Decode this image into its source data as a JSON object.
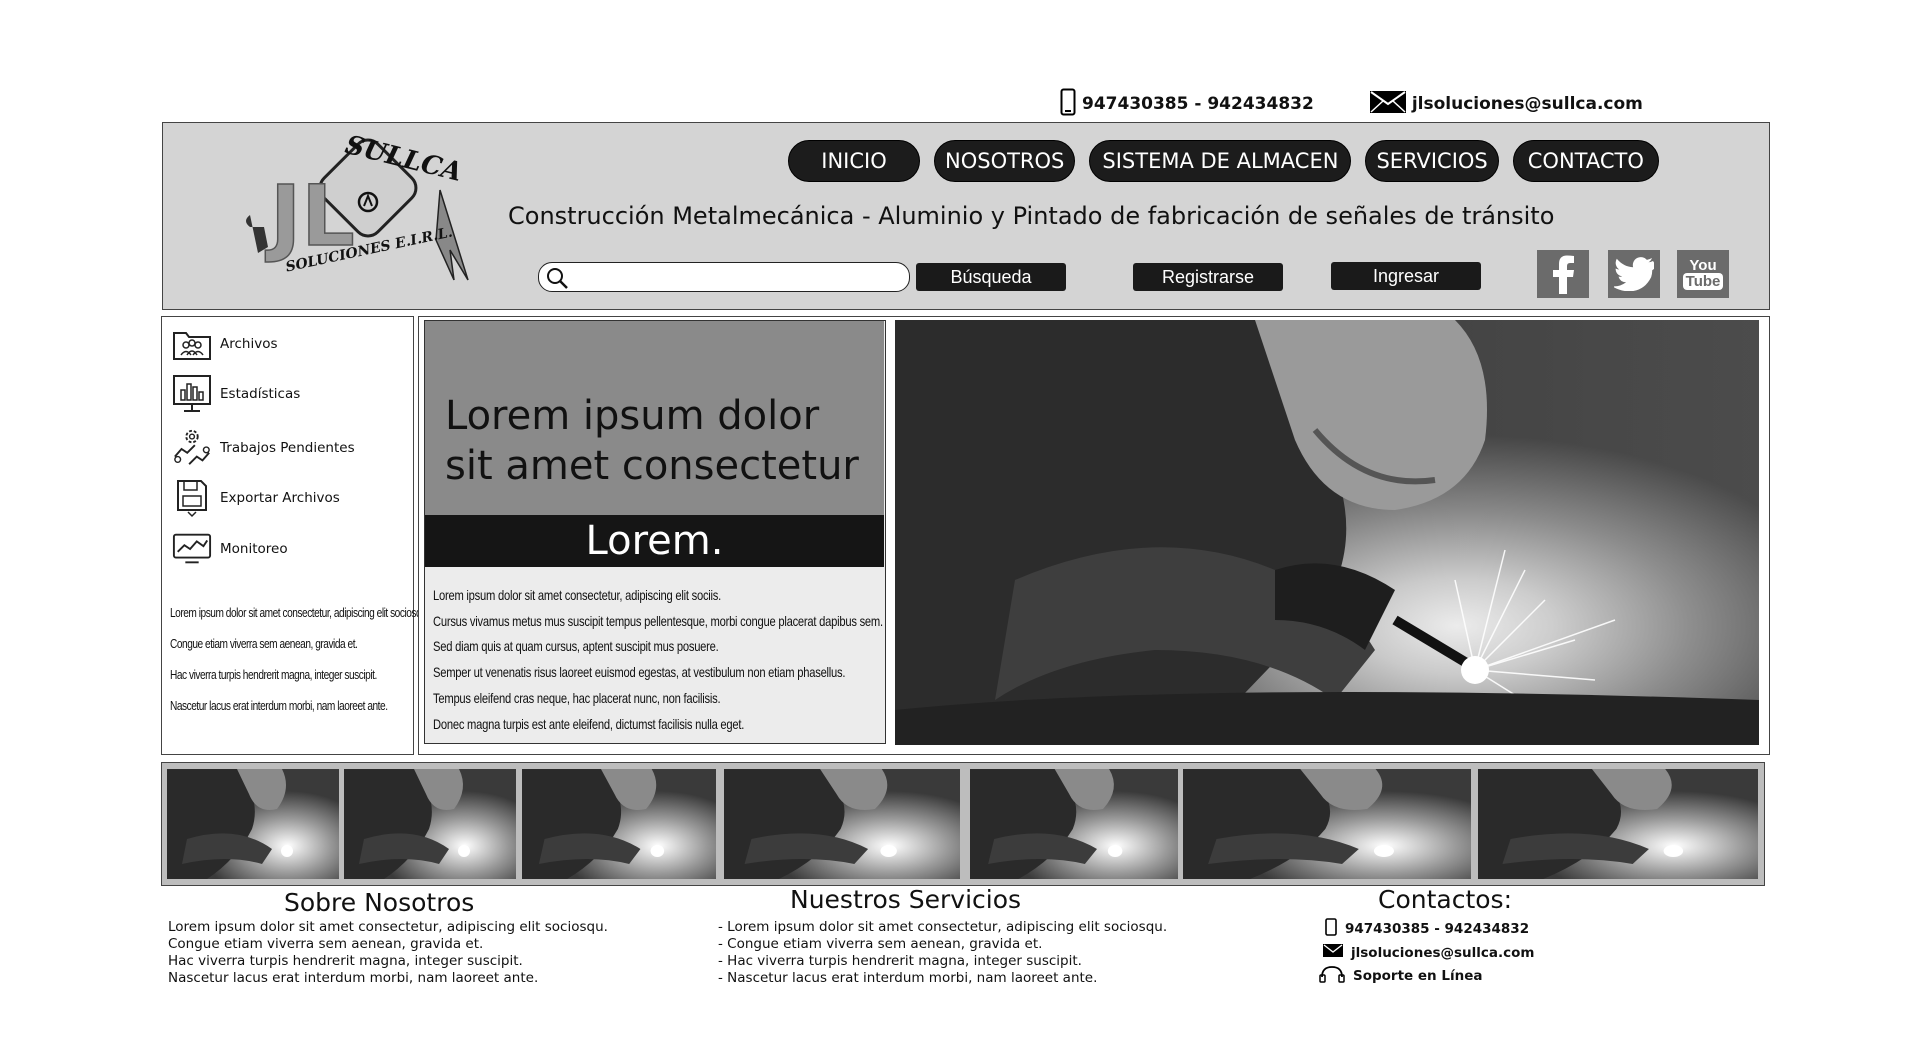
{
  "topbar": {
    "phone": "947430385 - 942434832",
    "email": "jlsoluciones@sullca.com"
  },
  "brand": {
    "logo_text_main": "JL",
    "logo_text_top": "SULLCA",
    "logo_text_bottom": "SOLUCIONES E.I.R.L."
  },
  "nav": {
    "items": [
      "INICIO",
      "NOSOTROS",
      "SISTEMA DE ALMACEN",
      "SERVICIOS",
      "CONTACTO"
    ]
  },
  "header": {
    "tagline": "Construcción Metalmecánica - Aluminio y Pintado de fabricación de señales de tránsito",
    "search_button": "Búsqueda",
    "register_button": "Registrarse",
    "login_button": "Ingresar",
    "social": [
      "facebook-icon",
      "twitter-icon",
      "youtube-icon"
    ],
    "youtube_text_1": "You",
    "youtube_text_2": "Tube"
  },
  "sidebar": {
    "items": [
      "Archivos",
      "Estadísticas",
      "Trabajos Pendientes",
      "Exportar Archivos",
      "Monitoreo"
    ],
    "text": [
      "Lorem ipsum dolor sit amet consectetur, adipiscing elit sociosqu.",
      "Congue etiam viverra sem aenean, gravida et.",
      "Hac viverra turpis hendrerit magna, integer suscipit.",
      "Nascetur lacus erat interdum morbi, nam laoreet ante."
    ]
  },
  "card": {
    "title_line1": "Lorem ipsum dolor",
    "title_line2": "sit amet consectetur",
    "band": "Lorem.",
    "lines": [
      "Lorem ipsum dolor sit amet consectetur, adipiscing elit sociis.",
      "Cursus vivamus metus mus suscipit tempus pellentesque, morbi congue placerat dapibus sem.",
      "Sed diam quis at quam cursus, aptent suscipit mus posuere.",
      "Semper ut venenatis risus laoreet euismod egestas, at vestibulum non etiam phasellus.",
      "Tempus eleifend cras neque, hac placerat nunc, non facilisis.",
      "Donec magna turpis est ante eleifend, dictumst facilisis nulla eget."
    ]
  },
  "footer": {
    "about_title": "Sobre Nosotros",
    "about_lines": [
      "Lorem ipsum dolor sit amet consectetur, adipiscing elit sociosqu.",
      "Congue etiam viverra sem aenean, gravida et.",
      "Hac viverra turpis hendrerit magna, integer suscipit.",
      "Nascetur lacus erat interdum morbi, nam laoreet ante."
    ],
    "services_title": "Nuestros Servicios",
    "services_lines": [
      "- Lorem ipsum dolor sit amet consectetur, adipiscing elit sociosqu.",
      "- Congue etiam viverra sem aenean, gravida et.",
      "- Hac viverra turpis hendrerit magna, integer suscipit.",
      "- Nascetur lacus erat interdum morbi, nam laoreet ante."
    ],
    "contact_title": "Contactos:",
    "contact_phone": "947430385 - 942434832",
    "contact_email": "jlsoluciones@sullca.com",
    "contact_support": "Soporte en Línea"
  }
}
